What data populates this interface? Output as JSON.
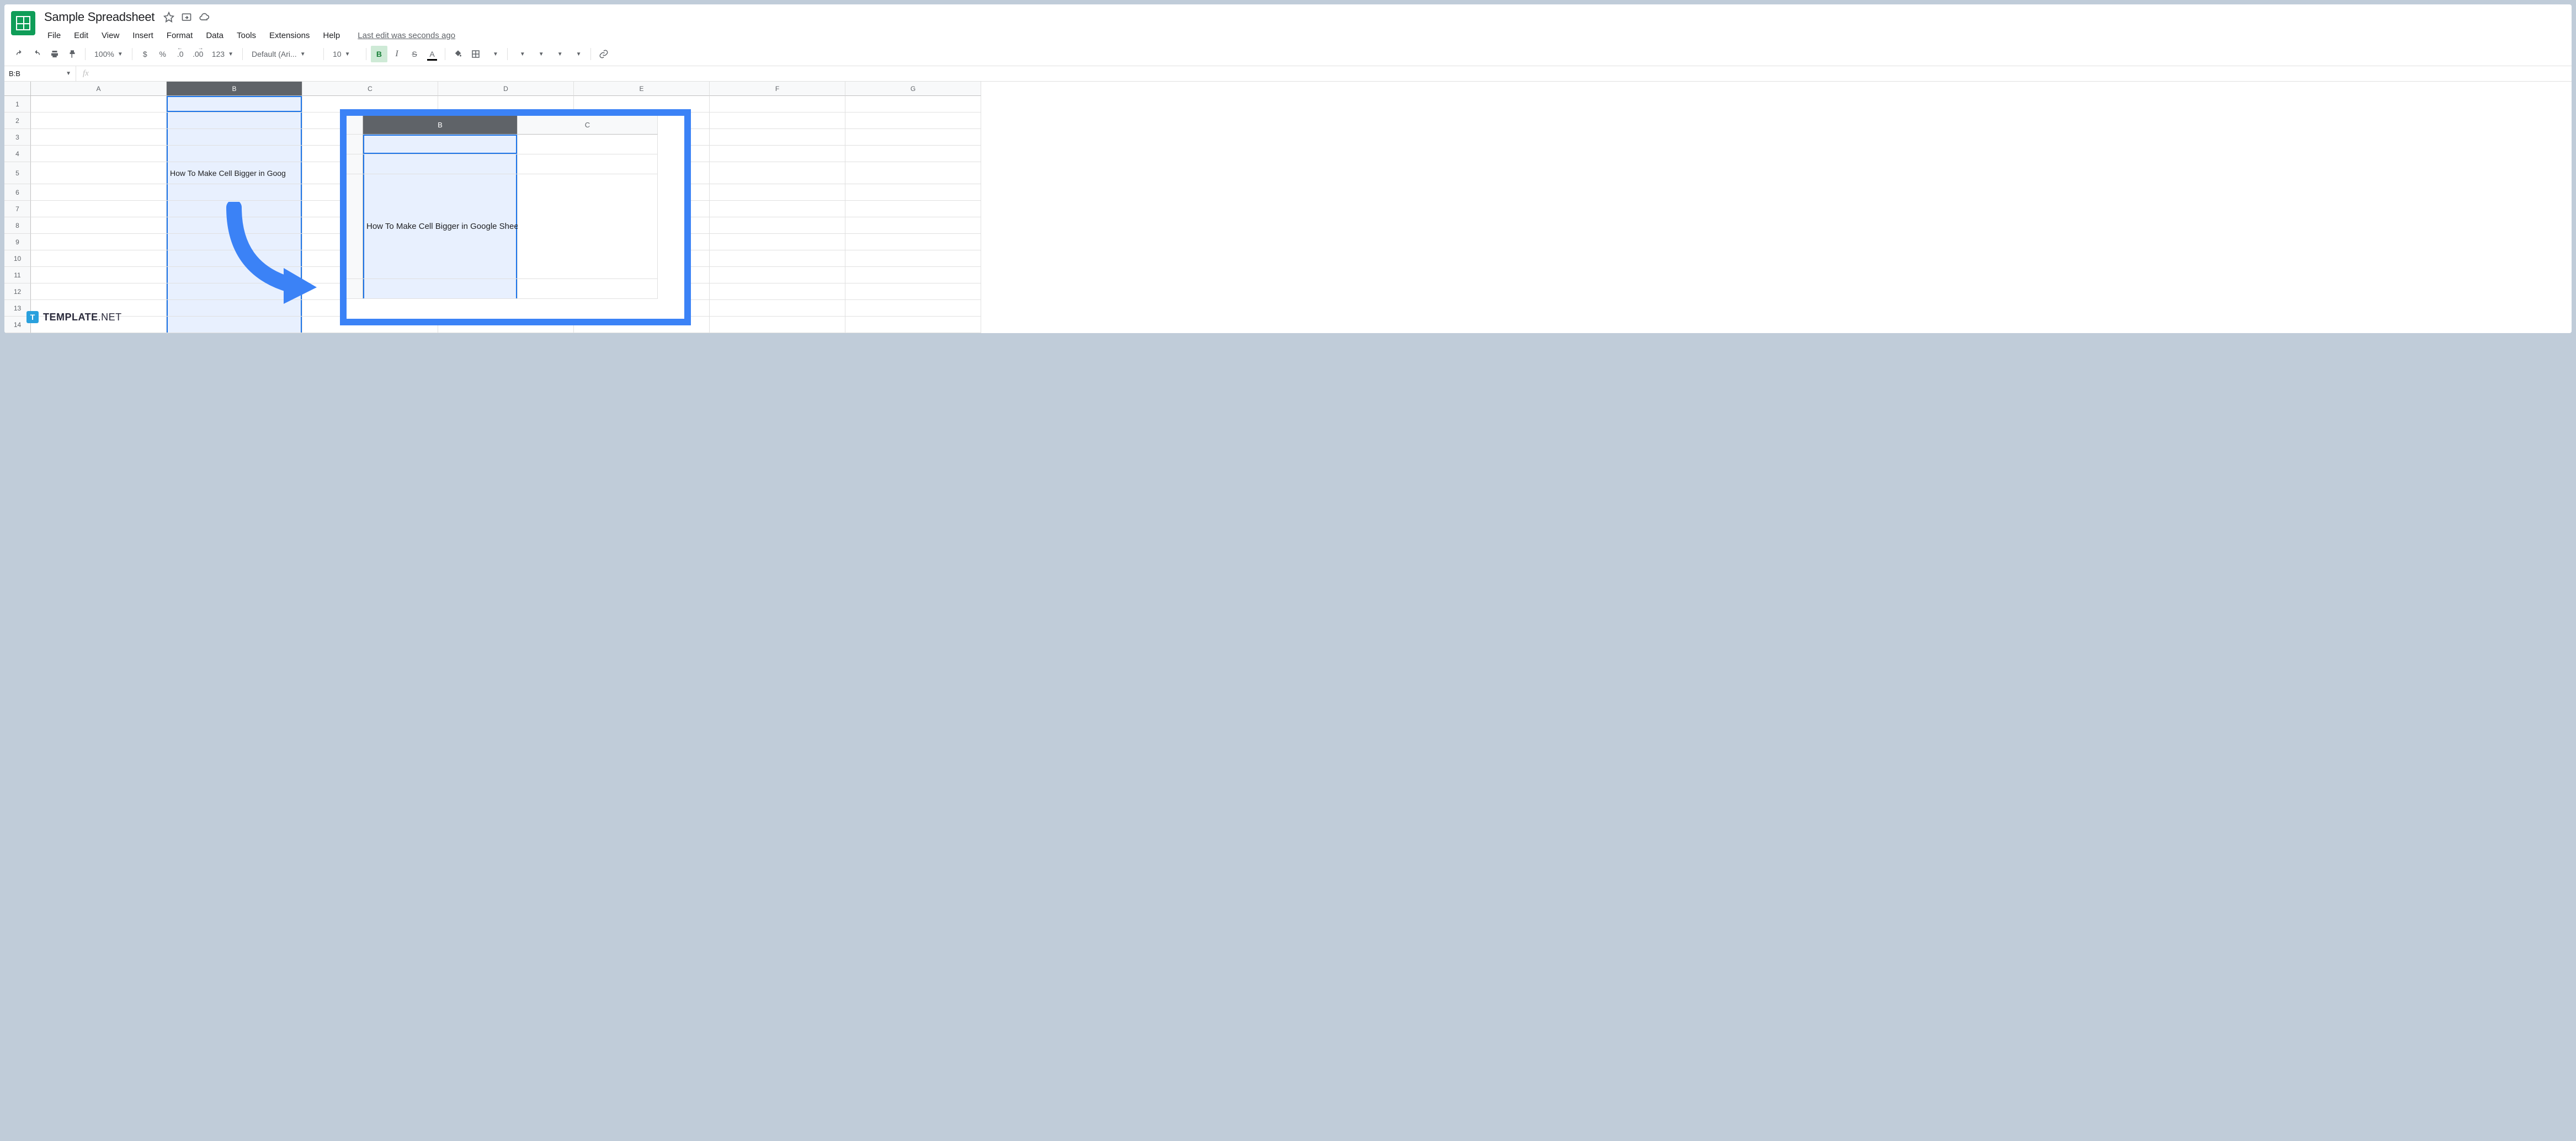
{
  "header": {
    "title": "Sample Spreadsheet",
    "last_edit": "Last edit was seconds ago"
  },
  "menubar": {
    "file": "File",
    "edit": "Edit",
    "view": "View",
    "insert": "Insert",
    "format": "Format",
    "data": "Data",
    "tools": "Tools",
    "extensions": "Extensions",
    "help": "Help"
  },
  "toolbar": {
    "zoom": "100%",
    "currency": "$",
    "percent": "%",
    "dec_dec": ".0",
    "inc_dec": ".00",
    "more_fmt": "123",
    "font": "Default (Ari...",
    "font_size": "10",
    "bold": "B",
    "italic": "I",
    "strike": "S",
    "text_color": "A"
  },
  "namebox": {
    "value": "B:B",
    "fx": "fx"
  },
  "columns": [
    "",
    "A",
    "B",
    "C",
    "D",
    "E",
    "F",
    "G"
  ],
  "rows": [
    "1",
    "2",
    "3",
    "4",
    "5",
    "6",
    "7",
    "8",
    "9",
    "10",
    "11",
    "12",
    "13",
    "14"
  ],
  "cells": {
    "b5": "How To Make Cell Bigger in Goog"
  },
  "overlay": {
    "col_b": "B",
    "col_c": "C",
    "text": "How To Make Cell Bigger in Google Sheets"
  },
  "watermark": {
    "logo": "T",
    "name": "TEMPLATE",
    "suffix": ".NET"
  }
}
